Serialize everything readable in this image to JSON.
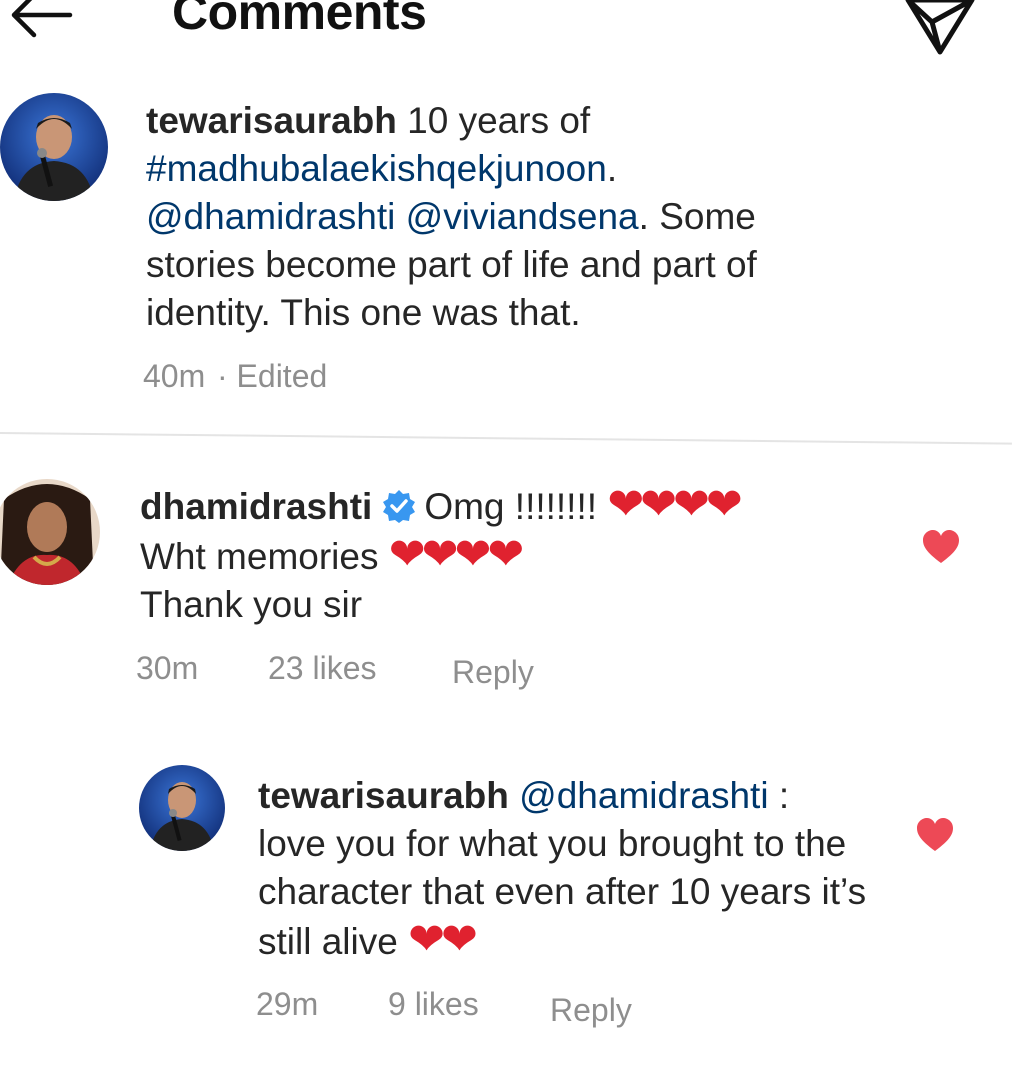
{
  "header": {
    "title": "Comments",
    "back_icon": "arrow-left-icon",
    "share_icon": "paper-plane-icon"
  },
  "caption": {
    "username": "tewarisaurabh",
    "text_1": "10 years of",
    "hashtag": "#madhubalaekishqekjunoon",
    "text_2": ".",
    "mention_1": "@dhamidrashti",
    "mention_2": "@viviandsena",
    "text_3": ". Some stories become part of life and part of identity. This one was that.",
    "time": "40m",
    "edited": "· Edited"
  },
  "comments": [
    {
      "username": "dhamidrashti",
      "verified": true,
      "text_line1": "Omg !!!!!!!!",
      "hearts_line1": "❤❤❤❤",
      "text_line2": "Wht memories",
      "hearts_line2": "❤❤❤❤",
      "text_line3": "Thank you sir",
      "time": "30m",
      "likes": "23 likes",
      "reply": "Reply",
      "liked": true
    },
    {
      "username": "tewarisaurabh",
      "mention": "@dhamidrashti",
      "text_1": " :",
      "text_2": "love you for what you brought to the character that even after 10 years it’s still alive",
      "hearts": "❤❤",
      "time": "29m",
      "likes": "9 likes",
      "reply": "Reply",
      "liked": true
    }
  ],
  "colors": {
    "link": "#00376b",
    "heart": "#e0222f",
    "like_heart": "#ed4956",
    "verified": "#3897f0",
    "meta": "#8e8e8e"
  }
}
